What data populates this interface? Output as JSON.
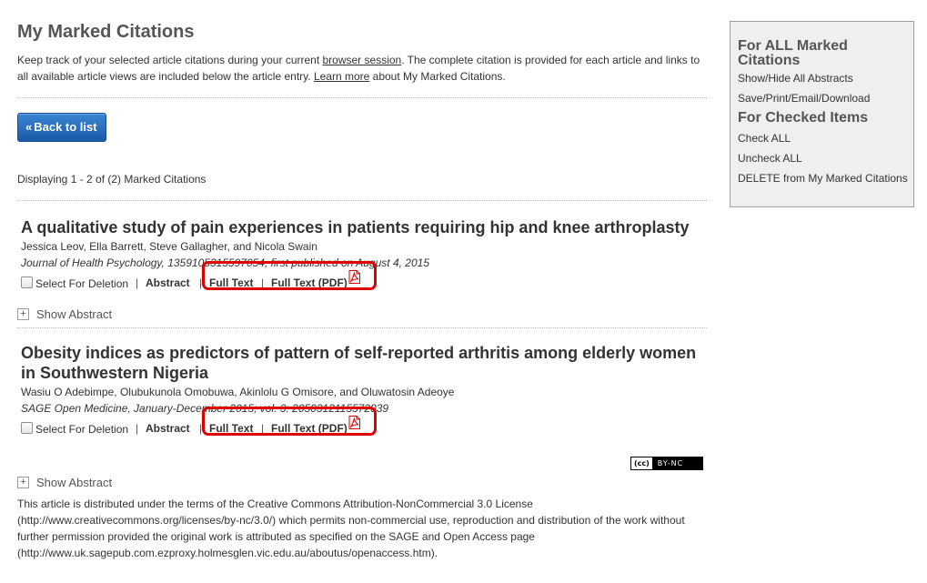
{
  "page": {
    "title": "My Marked Citations",
    "intro_part1": "Keep track of your selected article citations during your current ",
    "intro_link1": "browser session",
    "intro_part2": ". The complete citation is provided for each article and links to all available article views are included below the article entry. ",
    "intro_link2": "Learn more",
    "intro_part3": " about My Marked Citations.",
    "back_label": "Back to list",
    "displaying": "Displaying 1 - 2 of (2) Marked Citations"
  },
  "citations": [
    {
      "title": "A qualitative study of pain experiences in patients requiring hip and knee arthroplasty",
      "authors": "Jessica Leov, Ella Barrett, Steve Gallagher, and Nicola Swain",
      "journal": "Journal of Health Psychology, 1359105315597054, first published on August 4, 2015",
      "select_label": "Select For Deletion",
      "abstract_label": "Abstract",
      "fulltext_label": "Full Text",
      "pdf_label": "Full Text (PDF)",
      "show_abstract": "Show Abstract"
    },
    {
      "title": "Obesity indices as predictors of pattern of self-reported arthritis among elderly women in Southwestern Nigeria",
      "authors": "Wasiu O Adebimpe, Olubukunola Omobuwa, Akinlolu G Omisore, and Oluwatosin Adeoye",
      "journal": "SAGE Open Medicine, January-December 2015; vol. 3: 2050312115572039",
      "select_label": "Select For Deletion",
      "abstract_label": "Abstract",
      "fulltext_label": "Full Text",
      "pdf_label": "Full Text (PDF)",
      "show_abstract": "Show Abstract",
      "cc_badge_cc": "(cc)",
      "cc_badge_text": "BY-NC",
      "license": "This article is distributed under the terms of the Creative Commons Attribution-NonCommercial 3.0 License (http://www.creativecommons.org/licenses/by-nc/3.0/) which permits non-commercial use, reproduction and distribution of the work without further permission provided the original work is attributed as specified on the SAGE and Open Access page (http://www.uk.sagepub.com.ezproxy.holmesglen.vic.edu.au/aboutus/openaccess.htm)."
    }
  ],
  "sidebar": {
    "heading_all": "For ALL Marked Citations",
    "show_hide": "Show/Hide All Abstracts",
    "save_print": "Save/Print/Email/Download",
    "heading_checked": "For Checked Items",
    "check_all": "Check ALL",
    "uncheck_all": "Uncheck ALL",
    "delete": "DELETE from My Marked Citations"
  },
  "colors": {
    "button_blue": "#1a5aa8",
    "highlight_red": "#e00000",
    "pdf_red": "#d40000",
    "sidebar_bg": "#efefef"
  }
}
